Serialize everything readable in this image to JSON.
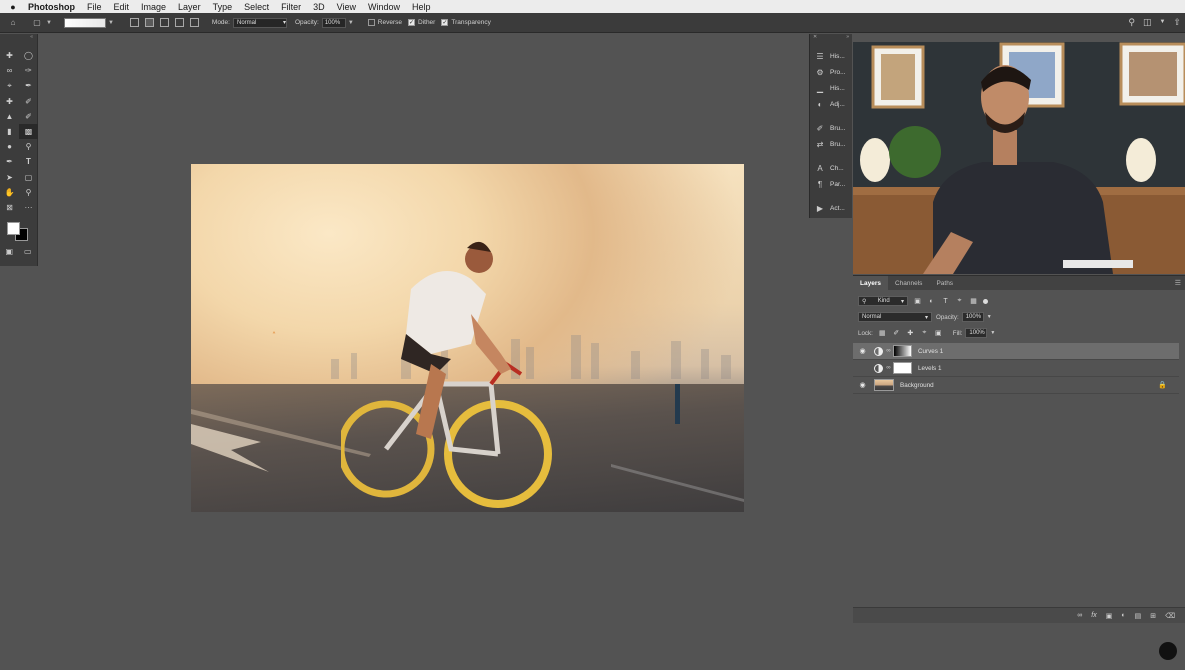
{
  "menubar": {
    "app": "Photoshop",
    "items": [
      "File",
      "Edit",
      "Image",
      "Layer",
      "Type",
      "Select",
      "Filter",
      "3D",
      "View",
      "Window",
      "Help"
    ]
  },
  "options": {
    "mode_label": "Mode:",
    "mode_value": "Normal",
    "opacity_label": "Opacity:",
    "opacity_value": "100%",
    "reverse_label": "Reverse",
    "dither_label": "Dither",
    "transparency_label": "Transparency",
    "reverse_checked": false,
    "dither_checked": true,
    "transparency_checked": true
  },
  "tools": {
    "fg_color": "#ffffff",
    "bg_color": "#000000"
  },
  "minipanel": {
    "items": [
      {
        "label": "His...",
        "icon": "history-icon"
      },
      {
        "label": "Pro...",
        "icon": "properties-icon"
      },
      {
        "label": "His...",
        "icon": "histogram-icon"
      },
      {
        "label": "Adj...",
        "icon": "adjustments-icon"
      },
      {
        "label": "Bru...",
        "icon": "brush-icon"
      },
      {
        "label": "Bru...",
        "icon": "brush-settings-icon"
      },
      {
        "label": "Ch...",
        "icon": "character-icon"
      },
      {
        "label": "Par...",
        "icon": "paragraph-icon"
      },
      {
        "label": "Act...",
        "icon": "actions-icon"
      }
    ]
  },
  "layers_panel": {
    "tabs": [
      "Layers",
      "Channels",
      "Paths"
    ],
    "kind_label": "Kind",
    "blend_mode": "Normal",
    "opacity_label": "Opacity:",
    "opacity_value": "100%",
    "lock_label": "Lock:",
    "fill_label": "Fill:",
    "fill_value": "100%",
    "layers": [
      {
        "name": "Curves 1",
        "visible": true,
        "selected": true,
        "type": "adjustment"
      },
      {
        "name": "Levels 1",
        "visible": false,
        "selected": false,
        "type": "adjustment"
      },
      {
        "name": "Background",
        "visible": true,
        "selected": false,
        "type": "image",
        "locked": true
      }
    ]
  }
}
